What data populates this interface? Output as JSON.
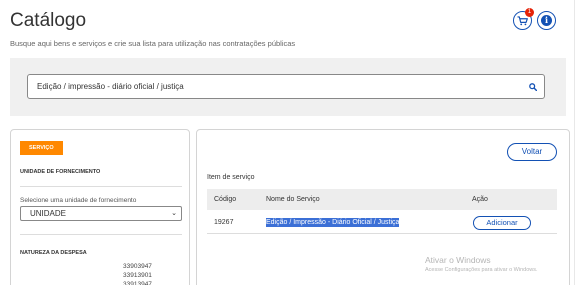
{
  "header": {
    "title": "Catálogo",
    "subtitle": "Busque aqui bens e serviços e crie sua lista para utilização nas contratações públicas",
    "cart_badge": "1",
    "info_glyph": "i"
  },
  "search": {
    "value": "Edição / impressão - diário oficial / justiça",
    "icon": "search-icon"
  },
  "filters": {
    "tag": "SERVIÇO",
    "unit_heading": "UNIDADE DE FORNECIMENTO",
    "unit_select_label": "Selecione uma unidade de fornecimento",
    "unit_selected": "UNIDADE",
    "nature_heading": "NATUREZA DA DESPESA",
    "nature_codes": [
      "33903947",
      "33913901",
      "33913947"
    ]
  },
  "results": {
    "back_label": "Voltar",
    "section_label": "Item de serviço",
    "columns": [
      "Código",
      "Nome do Serviço",
      "Ação"
    ],
    "rows": [
      {
        "code": "19267",
        "name": "Edição / Impressão - Diário Oficial / Justiça",
        "action": "Adicionar"
      }
    ]
  },
  "watermark": {
    "line1": "Ativar o Windows",
    "line2": "Acesse Configurações para ativar o Windows."
  },
  "colors": {
    "primary": "#1351b4",
    "tag": "#ff8800",
    "badge": "#e52207",
    "highlight": "#3b6fd6"
  }
}
